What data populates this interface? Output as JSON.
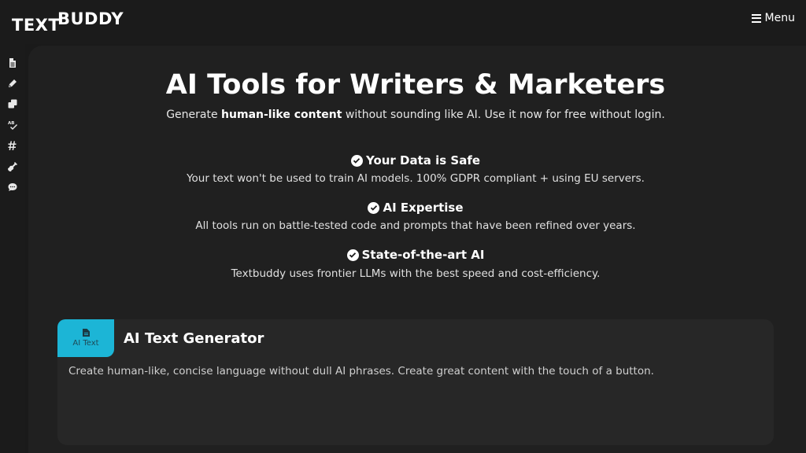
{
  "brand": {
    "logo_part1": "TEXT",
    "logo_part2": "BUDDY"
  },
  "header": {
    "menu_label": "Menu"
  },
  "sidebar": {
    "icons": [
      "document-icon",
      "pen-icon",
      "copy-icon",
      "spellcheck-icon",
      "hashtag-icon",
      "guitar-icon",
      "chat-icon"
    ]
  },
  "hero": {
    "title": "AI Tools for Writers & Marketers",
    "subtitle_prefix": "Generate ",
    "subtitle_bold": "human-like content",
    "subtitle_suffix": " without sounding like AI. Use it now for free without login."
  },
  "features": [
    {
      "title": "Your Data is Safe",
      "text": "Your text won't be used to train AI models. 100% GDPR compliant + using EU servers."
    },
    {
      "title": "AI Expertise",
      "text": "All tools run on battle-tested code and prompts that have been refined over years."
    },
    {
      "title": "State-of-the-art AI",
      "text": "Textbuddy uses frontier LLMs with the best speed and cost-efficiency."
    }
  ],
  "tool_card": {
    "badge_label": "AI Text",
    "title": "AI Text Generator",
    "description": "Create human-like, concise language without dull AI phrases. Create great content with the touch of a button."
  },
  "colors": {
    "accent": "#1cb5d6",
    "background": "#1a1a1a",
    "panel": "#202020",
    "card": "#272727"
  }
}
